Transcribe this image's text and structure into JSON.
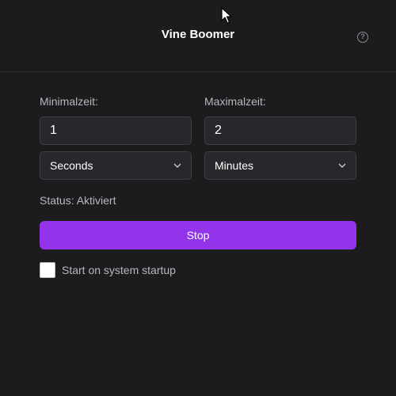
{
  "app": {
    "title": "Vine Boomer"
  },
  "header": {
    "help_icon_glyph": "?"
  },
  "form": {
    "min_label": "Minimalzeit:",
    "max_label": "Maximalzeit:",
    "min_value": "1",
    "max_value": "2",
    "min_unit": "Seconds",
    "max_unit": "Minutes"
  },
  "status": {
    "text": "Status: Aktiviert"
  },
  "actions": {
    "stop_label": "Stop"
  },
  "startup": {
    "label": "Start on system startup",
    "checked": false
  },
  "colors": {
    "background": "#1c1b1e",
    "accent": "#9333ea",
    "field_bg": "#28272b"
  },
  "icons": {
    "help": "question-circle-icon",
    "chevron": "chevron-down-icon",
    "cursor": "mouse-pointer-icon"
  }
}
